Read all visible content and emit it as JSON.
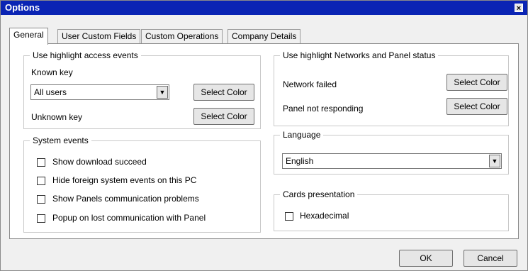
{
  "window": {
    "title": "Options",
    "close_glyph": "×"
  },
  "tabs": [
    {
      "label": "General"
    },
    {
      "label": "User Custom Fields"
    },
    {
      "label": "Custom Operations"
    },
    {
      "label": "Company Details"
    }
  ],
  "access_events": {
    "legend": "Use highlight access events",
    "known_key_label": "Known key",
    "known_key_select": {
      "value": "All users"
    },
    "known_select_color": "Select Color",
    "unknown_key_label": "Unknown key",
    "unknown_select_color": "Select Color"
  },
  "system_events": {
    "legend": "System events",
    "items": [
      {
        "label": "Show download succeed",
        "checked": false
      },
      {
        "label": "Hide foreign system events on this PC",
        "checked": false
      },
      {
        "label": "Show Panels communication problems",
        "checked": false
      },
      {
        "label": "Popup on lost communication with Panel",
        "checked": false
      }
    ]
  },
  "network_status": {
    "legend": "Use highlight Networks and Panel status",
    "network_failed_label": "Network failed",
    "network_select_color": "Select Color",
    "panel_label": "Panel not responding",
    "panel_select_color": "Select Color"
  },
  "language": {
    "legend": "Language",
    "value": "English"
  },
  "cards": {
    "legend": "Cards presentation",
    "hex_label": "Hexadecimal",
    "hex_checked": false
  },
  "buttons": {
    "ok": "OK",
    "cancel": "Cancel"
  },
  "colors": {
    "titlebar": "#0a24b4",
    "window_bg": "#f0f0f0"
  }
}
